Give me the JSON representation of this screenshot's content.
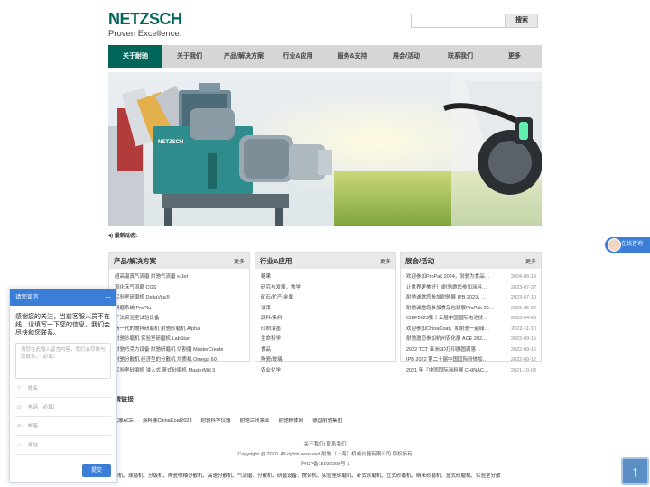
{
  "header": {
    "logo_word": "NETZSCH",
    "logo_tagline": "Proven Excellence",
    "search_placeholder": "",
    "search_button": "搜索"
  },
  "nav": [
    {
      "label": "关于耐驰",
      "active": true
    },
    {
      "label": "关于我们",
      "active": false
    },
    {
      "label": "产品/解决方案",
      "active": false
    },
    {
      "label": "行业&应用",
      "active": false
    },
    {
      "label": "服务&支持",
      "active": false
    },
    {
      "label": "展会/活动",
      "active": false
    },
    {
      "label": "联系我们",
      "active": false
    },
    {
      "label": "更多",
      "active": false
    }
  ],
  "banner": {
    "brand_text": "NETZSCH"
  },
  "news_bar": "最新动态:",
  "columns": {
    "products": {
      "title": "产品/解决方案",
      "more": "更多",
      "items": [
        "超高温真气流磨 耐驰气流磨 s-Jet",
        "流化床气流磨 CGS",
        "实验室研磨机 DeltaVita®",
        "研磨系统 ProPlu",
        "干法实验室试验设备",
        "新一代的搅拌研磨机 耐驰砂磨机 Alpha",
        "耐驰砂磨机 实验室研磨机 LabStar",
        "耐驰巧克力设备 耐驰研磨机 切割磨 MasterCreate",
        "耐驰分散机 经济型的分散机 均质机 Omega 60",
        "实验室砂磨机 浸入式 篮式砂磨机 MasterMill 3"
      ]
    },
    "industries": {
      "title": "行业&应用",
      "more": "更多",
      "items": [
        "糖果",
        "研究与发展，教学",
        "矿石/矿产/金属",
        "油漆",
        "颜料/染料",
        "印刷油墨",
        "生命科学",
        "食品",
        "陶瓷/玻璃",
        "农业化学"
      ]
    },
    "events": {
      "title": "展会/活动",
      "more": "更多",
      "items": [
        {
          "title": "欢迎参加ProPak 2024，耐驰为食品…",
          "date": "2024-06-19"
        },
        {
          "title": "让世界更美好！|耐驰邀您参加涂料…",
          "date": "2023-07-27"
        },
        {
          "title": "耐驰诚邀您参加耐驰展 IPB 2023，…",
          "date": "2023-07-10"
        },
        {
          "title": "耐驰诚邀您参加食品包装展ProPak 20…",
          "date": "2023-05-04"
        },
        {
          "title": "CIBF2023第十五届中国国际电池技…",
          "date": "2023-04-03"
        },
        {
          "title": "欢迎参加ChinaCoat，和耐驰一起绿…",
          "date": "2022-11-10"
        },
        {
          "title": "耐驰邀您参加杭州农化展 ACE 202…",
          "date": "2022-09-15"
        },
        {
          "title": "2022 TCT 亚洲3D打印展圆满落…",
          "date": "2022-09-15"
        },
        {
          "title": "IPB 2022 第二十届中国国际粉体加…",
          "date": "2022-09-12"
        },
        {
          "title": "2021 年『中国国际涂料展 CHINAC…",
          "date": "2021-10-08"
        }
      ]
    }
  },
  "links_title": "友情链接",
  "links": [
    "农化展ACE",
    "涂料展ChinaCoat2023",
    "耐驰科学仪器",
    "耐驰兰州泵业",
    "耐驰粉体网",
    "德国耐驰集团"
  ],
  "footer": {
    "line1": "关于我们| 联系我们",
    "line2": "Copyright @ 2020. All rights reserved.耐驰（上海）机械仪器有限公司 版权所有",
    "line3": "沪ICP备15032298号-1"
  },
  "tags": "干燥机、球磨机、分级机、陶瓷喷釉分散机、高速分散机、气流磨、分散机、研磨设备、搅合机、实验室砂磨机、卧式砂磨机、立式砂磨机、纳米砂磨机、篮式砂磨机、实验室分散",
  "chat": {
    "header": "请您留言",
    "minimize": "—",
    "intro": "感谢您的关注，当前客服人员不在线，请填写一下您的信息，我们会尽快和您联系。",
    "message_placeholder": "请您在此输入留言内容，我们会尽快与您联系。（必填）",
    "fields": [
      {
        "icon": "user-icon",
        "glyph": "☺",
        "label": "姓名"
      },
      {
        "icon": "phone-icon",
        "glyph": "☏",
        "label": "电话（必填）"
      },
      {
        "icon": "mail-icon",
        "glyph": "✉",
        "label": "邮箱"
      },
      {
        "icon": "home-icon",
        "glyph": "⌂",
        "label": "地址"
      }
    ],
    "submit": "提交"
  },
  "online_label": "在线咨询",
  "totop_glyph": "↑",
  "colors": {
    "brand": "#00665c",
    "chat_blue": "#3b7ed8",
    "nav_bg": "#d6d6d6"
  }
}
